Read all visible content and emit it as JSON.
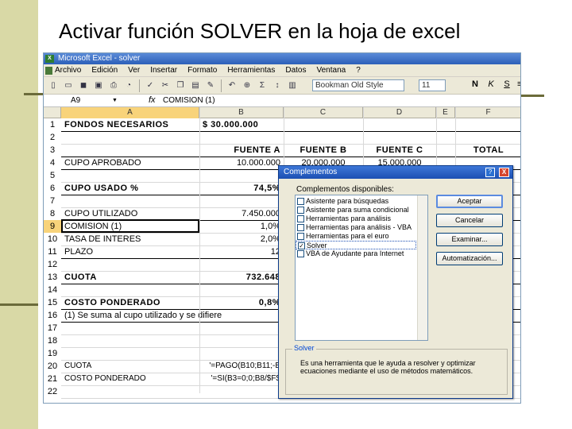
{
  "slide": {
    "title": "Activar función SOLVER en la hoja de excel"
  },
  "excel": {
    "window_title": "Microsoft Excel - solver",
    "app_icon_text": "X",
    "menu": [
      "Archivo",
      "Edición",
      "Ver",
      "Insertar",
      "Formato",
      "Herramientas",
      "Datos",
      "Ventana",
      "?"
    ],
    "font_name": "Bookman Old Style",
    "font_size": "11",
    "format_buttons": [
      "N",
      "K",
      "S"
    ],
    "name_box": "A9",
    "fx_symbol": "fx",
    "formula": "COMISION (1)",
    "columns": [
      "A",
      "B",
      "C",
      "D",
      "E",
      "F"
    ],
    "active_column": "A",
    "active_row": "9",
    "rows": [
      {
        "num": "1",
        "a": "FONDOS NECESARIOS",
        "b": "$ 30.000.000",
        "c": "",
        "d": "",
        "f": ""
      },
      {
        "num": "2",
        "a": "",
        "b": "",
        "c": "",
        "d": "",
        "f": ""
      },
      {
        "num": "3",
        "a": "",
        "b": "FUENTE A",
        "c": "FUENTE B",
        "d": "FUENTE C",
        "f": "TOTAL"
      },
      {
        "num": "4",
        "a": "CUPO APROBADO",
        "b": "10.000.000",
        "c": "20.000.000",
        "d": "15.000.000",
        "f": ""
      },
      {
        "num": "5",
        "a": "",
        "b": "",
        "c": "",
        "d": "",
        "f": ""
      },
      {
        "num": "6",
        "a": "CUPO USADO %",
        "b": "74,5%",
        "c": "",
        "d": "",
        "f": ""
      },
      {
        "num": "7",
        "a": "",
        "b": "",
        "c": "",
        "d": "",
        "f": ""
      },
      {
        "num": "8",
        "a": "CUPO UTILIZADO",
        "b": "7.450.000",
        "c": "",
        "d": "",
        "f": ""
      },
      {
        "num": "9",
        "a": "COMISION (1)",
        "b": "1,0%",
        "c": "",
        "d": "",
        "f": ""
      },
      {
        "num": "10",
        "a": "TASA DE INTERES",
        "b": "2,0%",
        "c": "",
        "d": "",
        "f": ""
      },
      {
        "num": "11",
        "a": "PLAZO",
        "b": "12",
        "c": "",
        "d": "",
        "f": ""
      },
      {
        "num": "12",
        "a": "",
        "b": "",
        "c": "",
        "d": "",
        "f": ""
      },
      {
        "num": "13",
        "a": "CUOTA",
        "b": "732.648",
        "c": "",
        "d": "",
        "f": ""
      },
      {
        "num": "14",
        "a": "",
        "b": "",
        "c": "",
        "d": "",
        "f": ""
      },
      {
        "num": "15",
        "a": "COSTO PONDERADO",
        "b": "0,8%",
        "c": "",
        "d": "",
        "f": ""
      },
      {
        "num": "16",
        "a": "(1) Se suma al cupo utilizado y se difiere",
        "b": "",
        "c": "",
        "d": "",
        "f": ""
      },
      {
        "num": "17",
        "a": "",
        "b": "",
        "c": "",
        "d": "",
        "f": ""
      },
      {
        "num": "18",
        "a": "",
        "b": "",
        "c": "",
        "d": "",
        "f": ""
      },
      {
        "num": "19",
        "a": "",
        "b": "",
        "c": "",
        "d": "",
        "f": ""
      },
      {
        "num": "20",
        "a": "CUOTA",
        "b": "'=PAGO(B10;B11;-B",
        "c": "",
        "d": "",
        "f": ""
      },
      {
        "num": "21",
        "a": "COSTO PONDERADO",
        "b": "'=SI(B3=0;0;B8/$F$",
        "c": "",
        "d": "",
        "f": ""
      },
      {
        "num": "22",
        "a": "",
        "b": "",
        "c": "",
        "d": "",
        "f": ""
      }
    ]
  },
  "dialog": {
    "title": "Complementos",
    "help_label": "?",
    "close_label": "X",
    "list_label": "Complementos disponibles:",
    "addins": [
      {
        "label": "Asistente para búsquedas",
        "checked": false,
        "check_mark": ""
      },
      {
        "label": "Asistente para suma condicional",
        "checked": false,
        "check_mark": ""
      },
      {
        "label": "Herramientas para análisis",
        "checked": false,
        "check_mark": ""
      },
      {
        "label": "Herramientas para análisis - VBA",
        "checked": false,
        "check_mark": ""
      },
      {
        "label": "Herramientas para el euro",
        "checked": false,
        "check_mark": ""
      },
      {
        "label": "Solver",
        "checked": true,
        "check_mark": "✓"
      },
      {
        "label": "VBA de Ayudante para Internet",
        "checked": false,
        "check_mark": ""
      }
    ],
    "buttons": {
      "accept": "Aceptar",
      "cancel": "Cancelar",
      "browse": "Examinar...",
      "automation": "Automatización..."
    },
    "group_label": "Solver",
    "description": "Es una herramienta que le ayuda a resolver y optimizar ecuaciones mediante el uso de métodos matemáticos."
  }
}
